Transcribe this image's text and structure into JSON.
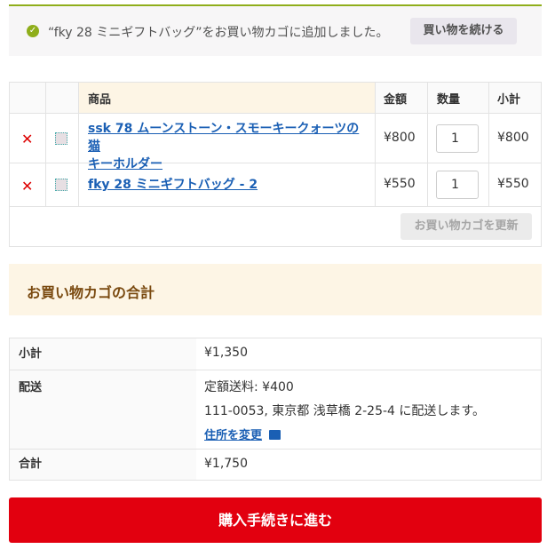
{
  "notice": {
    "message": "“fky 28 ミニギフトバッグ”をお買い物カゴに追加しました。",
    "continue_label": "買い物を続ける"
  },
  "cart": {
    "headers": {
      "product": "商品",
      "price": "金額",
      "qty": "数量",
      "subtotal": "小計"
    },
    "rows": [
      {
        "name": "ssk 78 ムーンストーン・スモーキークォーツの猫キーホルダー",
        "name_line1": "ssk 78 ムーンストーン・スモーキークォーツの猫",
        "name_line2": "キーホルダー",
        "price": "¥800",
        "qty": "1",
        "subtotal": "¥800"
      },
      {
        "name": "fky 28 ミニギフトバッグ - 2",
        "price": "¥550",
        "qty": "1",
        "subtotal": "¥550"
      }
    ],
    "update_label": "お買い物カゴを更新"
  },
  "totals": {
    "title": "お買い物カゴの合計",
    "subtotal_label": "小計",
    "subtotal_value": "¥1,350",
    "shipping_label": "配送",
    "shipping_rate": "定額送料: ¥400",
    "shipping_dest": "111-0053, 東京都 浅草橋 2-25-4 に配送します。",
    "change_address": "住所を変更",
    "total_label": "合計",
    "total_value": "¥1,750"
  },
  "checkout_label": "購入手続きに進む",
  "colors": {
    "accent_green": "#8fae1b",
    "checkout_red": "#e2000f",
    "link_blue": "#1a5fb4",
    "totals_bg": "#fdf5e5"
  },
  "icons": {
    "success": "check-circle-icon",
    "remove": "remove-x-icon",
    "thumb": "product-thumbnail-icon",
    "truck": "truck-icon"
  }
}
